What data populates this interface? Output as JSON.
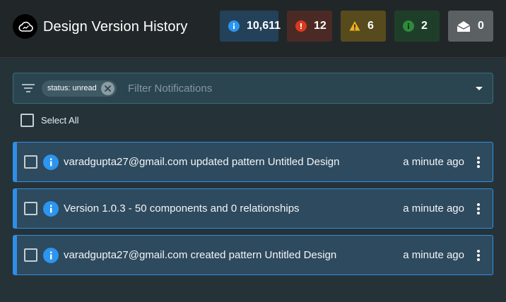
{
  "header": {
    "title": "Design Version History",
    "logo_icon": "cloud-icon",
    "badges": [
      {
        "type": "info",
        "count": "10,611",
        "icon": "info-icon",
        "color": "#23425a"
      },
      {
        "type": "error",
        "count": "12",
        "icon": "error-icon",
        "color": "#4b2a26"
      },
      {
        "type": "warning",
        "count": "6",
        "icon": "warning-icon",
        "color": "#574b1e"
      },
      {
        "type": "success",
        "count": "2",
        "icon": "success-icon",
        "color": "#1f3e2a"
      },
      {
        "type": "read",
        "count": "0",
        "icon": "open-envelope-icon",
        "color": "#5b6163"
      }
    ]
  },
  "filter": {
    "chip_label": "status: unread",
    "placeholder": "Filter Notifications",
    "value": ""
  },
  "select_all_label": "Select All",
  "accent_color": "#2f8ee6",
  "notifications": [
    {
      "message": "varadgupta27@gmail.com updated pattern Untitled Design",
      "time": "a minute ago",
      "severity": "info"
    },
    {
      "message": "Version 1.0.3 - 50 components and 0 relationships",
      "time": "a minute ago",
      "severity": "info"
    },
    {
      "message": "varadgupta27@gmail.com created pattern Untitled Design",
      "time": "a minute ago",
      "severity": "info"
    }
  ]
}
